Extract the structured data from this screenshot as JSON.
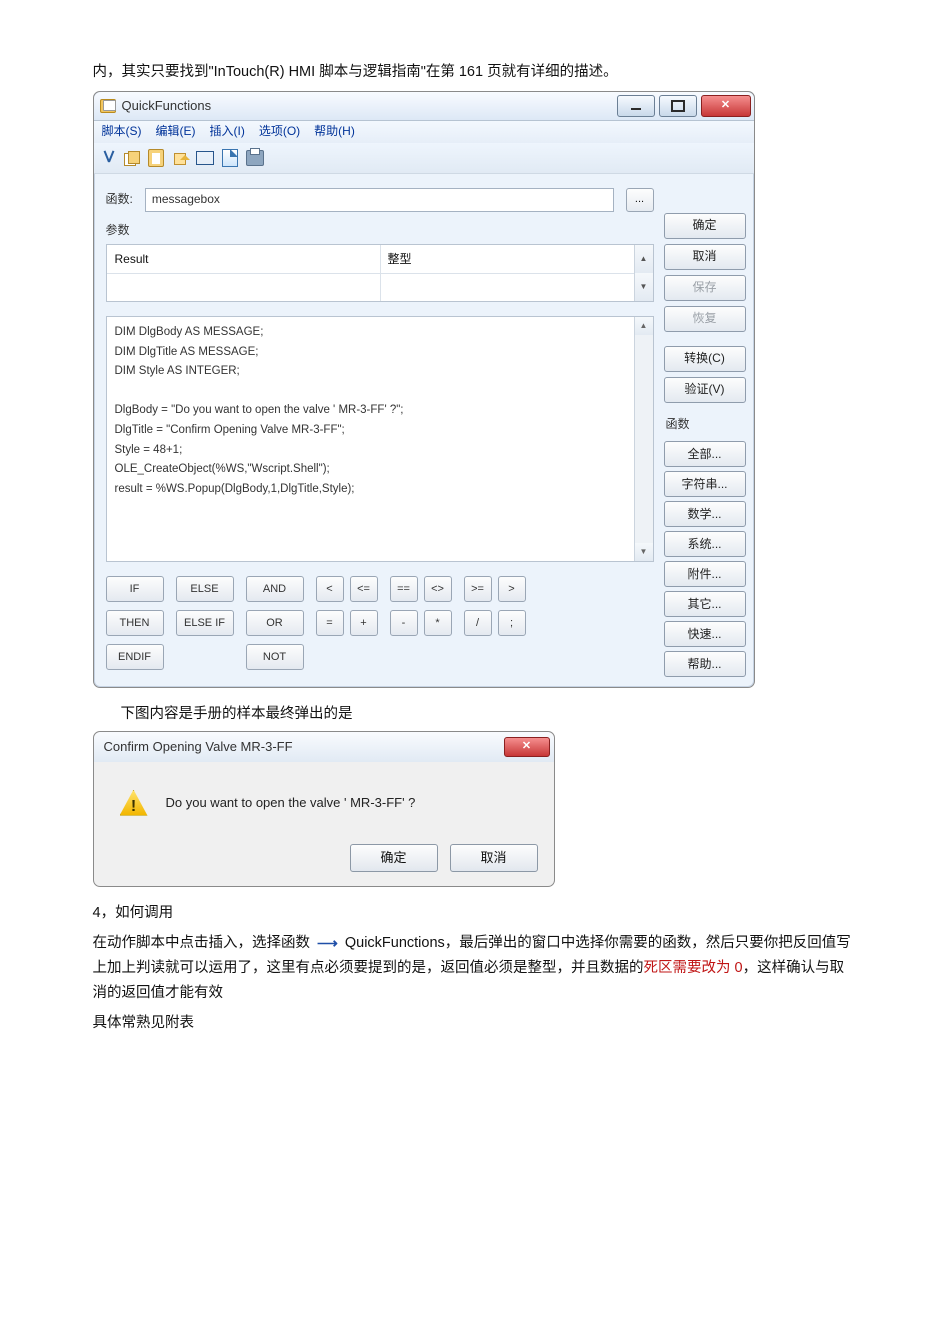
{
  "intro_text": "内，其实只要找到\"InTouch(R) HMI  脚本与逻辑指南\"在第 161 页就有详细的描述。",
  "window": {
    "title": "QuickFunctions",
    "menus": [
      "脚本(S)",
      "编辑(E)",
      "插入(I)",
      "选项(O)",
      "帮助(H)"
    ],
    "function_label": "函数:",
    "function_name": "messagebox",
    "params_label": "参数",
    "param_name": "Result",
    "param_type": "整型",
    "script": "DIM DlgBody AS MESSAGE;\nDIM DlgTitle AS MESSAGE;\nDIM Style AS INTEGER;\n\nDlgBody = \"Do you want to open the valve ' MR-3-FF' ?\";\nDlgTitle = \"Confirm Opening Valve MR-3-FF\";\nStyle = 48+1;\nOLE_CreateObject(%WS,\"Wscript.Shell\");\nresult = %WS.Popup(DlgBody,1,DlgTitle,Style);",
    "kw_row1": [
      "IF",
      "ELSE",
      "AND"
    ],
    "kw_row2": [
      "THEN",
      "ELSE IF",
      "OR"
    ],
    "kw_row3": [
      "ENDIF",
      "",
      "NOT"
    ],
    "ops_row1": [
      "<",
      "<=",
      "==",
      "<>",
      ">=",
      ">"
    ],
    "ops_row2": [
      "=",
      "+",
      "-",
      "*",
      "/",
      ";"
    ],
    "side": {
      "ok": "确定",
      "cancel": "取消",
      "save": "保存",
      "restore": "恢复",
      "convert": "转换(C)",
      "validate": "验证(V)",
      "group_label": "函数",
      "all": "全部...",
      "string": "字符串...",
      "math": "数学...",
      "system": "系统...",
      "addon": "附件...",
      "other": "其它...",
      "quick": "快速...",
      "help": "帮助..."
    }
  },
  "caption2": "下图内容是手册的样本最终弹出的是",
  "dialog": {
    "title": "Confirm Opening Valve MR-3-FF",
    "message": "Do you want to open the valve '   MR-3-FF'   ?",
    "ok": "确定",
    "cancel": "取消"
  },
  "section4_title": "4，如何调用",
  "para1a": "在动作脚本中点击插入，选择函数 ",
  "para1b": " QuickFunctions，最后弹出的窗口中选择你需要的函数，然后只要你把反回值写上加上判读就可以运用了，这里有点必须要提到的是，返回值必须是整型，并且数据的",
  "red_text": "死区需要改为 0",
  "para1c": "，这样确认与取消的返回值才能有效",
  "para2": "具体常熟见附表"
}
